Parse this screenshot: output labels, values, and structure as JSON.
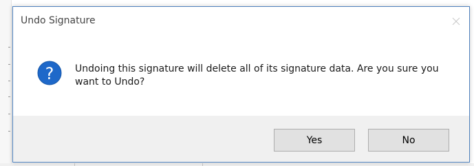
{
  "dialog": {
    "title": "Undo Signature",
    "message": "Undoing this signature will delete all of its signature data. Are you sure you want to Undo?",
    "icon": "question-icon",
    "close_icon": "close-icon",
    "buttons": {
      "yes_label": "Yes",
      "no_label": "No"
    }
  },
  "colors": {
    "icon_blue": "#1e68c9",
    "footer_bg": "#f0f0f0",
    "button_bg": "#e1e1e1",
    "dialog_border": "#4f81bd"
  }
}
